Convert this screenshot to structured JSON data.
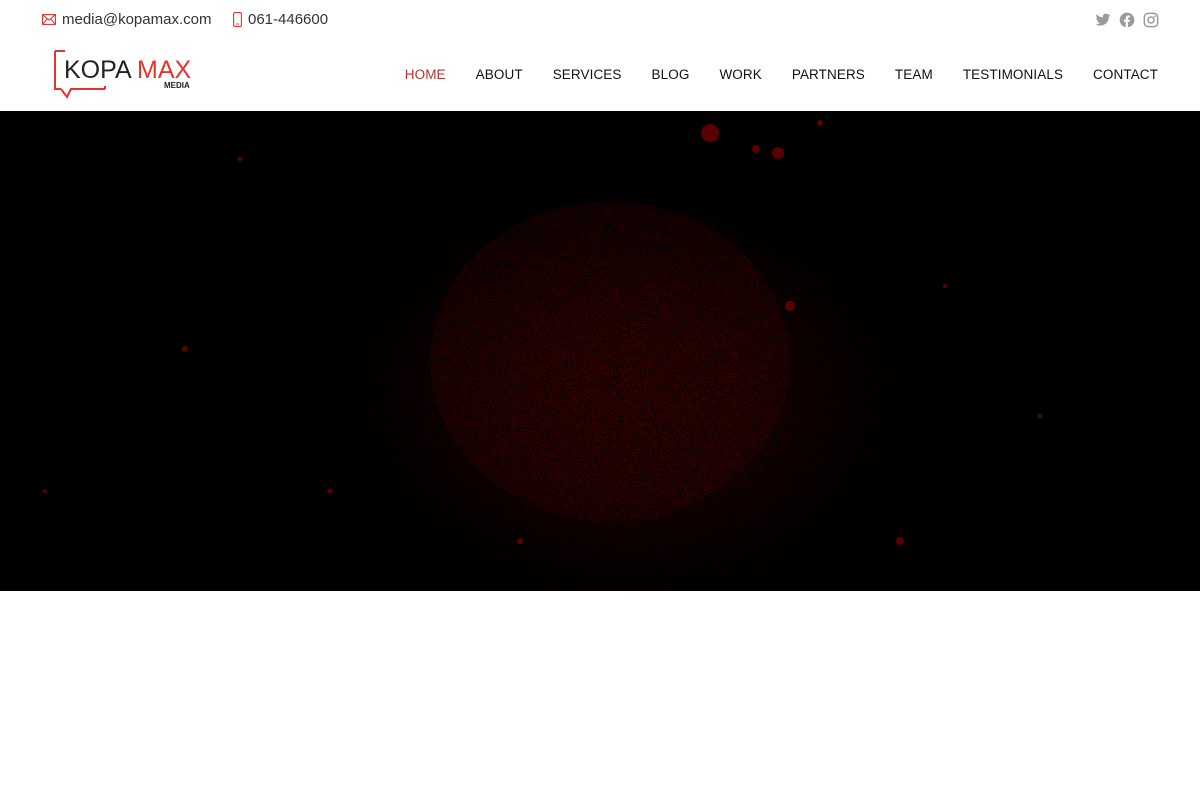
{
  "topbar": {
    "email": "media@kopamax.com",
    "phone": "061-446600",
    "social": [
      {
        "name": "twitter",
        "icon": "twitter-icon"
      },
      {
        "name": "facebook",
        "icon": "facebook-icon"
      },
      {
        "name": "instagram",
        "icon": "instagram-icon"
      }
    ]
  },
  "logo": {
    "text_main": "KOPA",
    "text_accent": "MAX",
    "subtext": "MEDIA"
  },
  "nav": {
    "items": [
      {
        "label": "HOME",
        "active": true
      },
      {
        "label": "ABOUT",
        "active": false
      },
      {
        "label": "SERVICES",
        "active": false
      },
      {
        "label": "BLOG",
        "active": false
      },
      {
        "label": "WORK",
        "active": false
      },
      {
        "label": "PARTNERS",
        "active": false
      },
      {
        "label": "TEAM",
        "active": false
      },
      {
        "label": "TESTIMONIALS",
        "active": false
      },
      {
        "label": "CONTACT",
        "active": false
      }
    ]
  },
  "colors": {
    "accent": "#e3342f",
    "nav_active": "#b5332f",
    "icon_gray": "#9a9a9a",
    "hero_bg": "#000000",
    "hero_splash": "#5a0000"
  }
}
